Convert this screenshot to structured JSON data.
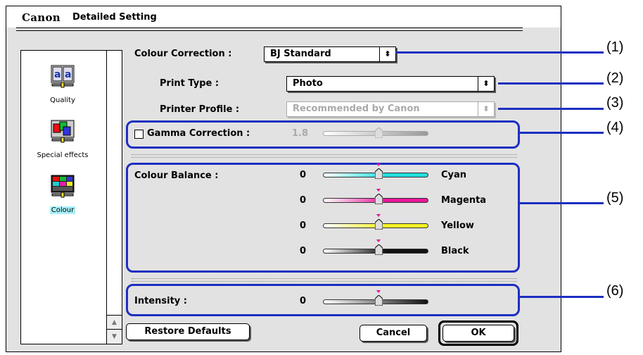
{
  "window": {
    "brand": "Canon",
    "title": "Detailed Setting"
  },
  "sidebar": {
    "items": [
      {
        "label": "Quality",
        "icon": "quality-icon"
      },
      {
        "label": "Special effects",
        "icon": "special-effects-icon"
      },
      {
        "label": "Colour",
        "icon": "colour-icon",
        "selected": true
      }
    ],
    "scroll_up": "▲",
    "scroll_down": "▼"
  },
  "colour_correction": {
    "label": "Colour Correction :",
    "value": "BJ Standard"
  },
  "print_type": {
    "label": "Print Type :",
    "value": "Photo"
  },
  "printer_profile": {
    "label": "Printer Profile :",
    "value": "Recommended by Canon",
    "enabled": false
  },
  "gamma": {
    "label": "Gamma Correction :",
    "value": "1.8",
    "checked": false
  },
  "colour_balance": {
    "label": "Colour Balance :",
    "sliders": [
      {
        "name": "Cyan",
        "value": "0",
        "color": "#22dddd"
      },
      {
        "name": "Magenta",
        "value": "0",
        "color": "#e8169a"
      },
      {
        "name": "Yellow",
        "value": "0",
        "color": "#f5f522"
      },
      {
        "name": "Black",
        "value": "0",
        "color": "#111111"
      }
    ]
  },
  "intensity": {
    "label": "Intensity :",
    "value": "0"
  },
  "buttons": {
    "restore": "Restore Defaults",
    "cancel": "Cancel",
    "ok": "OK"
  },
  "callouts": [
    "(1)",
    "(2)",
    "(3)",
    "(4)",
    "(5)",
    "(6)"
  ],
  "colors": {
    "callout_blue": "#1c2fc0",
    "window_bg": "#e2e2e2",
    "selected_label_bg": "#a8f0f8"
  }
}
